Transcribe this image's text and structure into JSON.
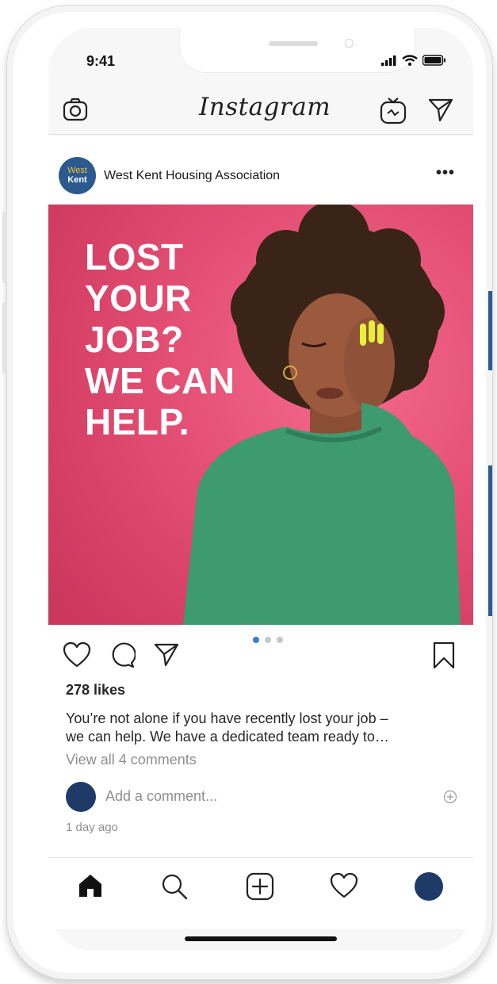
{
  "status_bar": {
    "time": "9:41"
  },
  "header": {
    "logo_text": "Instagram",
    "icons": [
      "camera-icon",
      "igtv-icon",
      "direct-message-icon"
    ]
  },
  "post": {
    "account_avatar": {
      "line1": "West",
      "line2": "Kent"
    },
    "username": "West Kent Housing Association",
    "more_label": "•••",
    "image_headline": [
      "LOST",
      "YOUR",
      "JOB?",
      "WE CAN",
      "HELP."
    ],
    "carousel": {
      "count": 3,
      "active_index": 0
    },
    "likes": "278 likes",
    "caption_lines": [
      "You’re not alone if you have recently lost your job –",
      "we can help. We have a dedicated team ready to…"
    ],
    "view_comments": "View all 4 comments",
    "comment_placeholder": "Add a comment...",
    "timestamp": "1 day ago"
  },
  "tabbar": {
    "items": [
      "home-icon",
      "search-icon",
      "new-post-icon",
      "activity-icon",
      "profile-icon"
    ]
  },
  "colors": {
    "image_bg": "#e8557a",
    "sweater": "#3e9a6f",
    "avatar_brand": "#2a5a8e",
    "profile_avatar": "#1e3a66",
    "carousel_active": "#3d7ad6"
  }
}
